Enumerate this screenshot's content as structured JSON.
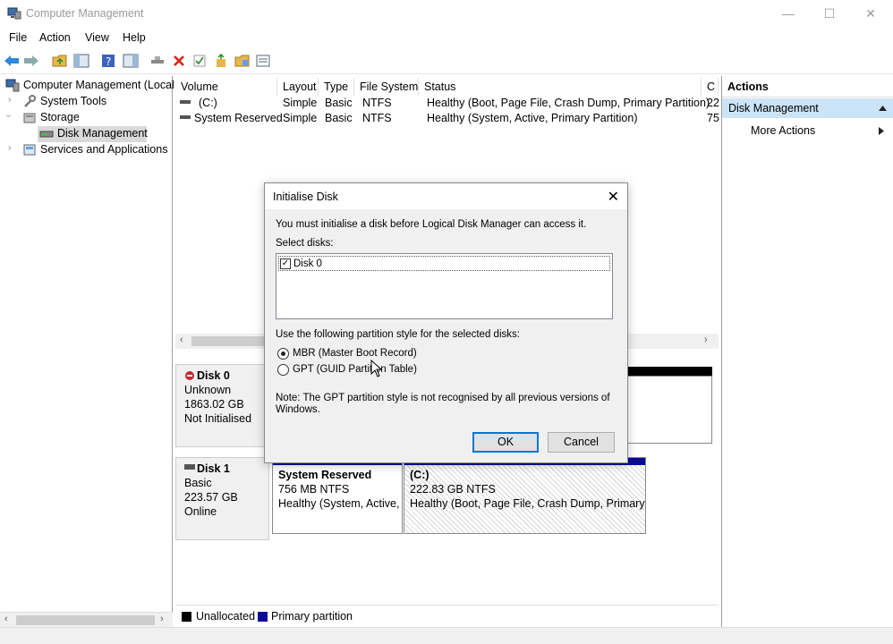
{
  "window": {
    "title": "Computer Management",
    "minimize": "—",
    "maximize": "☐",
    "close": "✕"
  },
  "menu": [
    "File",
    "Action",
    "View",
    "Help"
  ],
  "tree": {
    "root": "Computer Management (Local",
    "system_tools": "System Tools",
    "storage": "Storage",
    "disk_management": "Disk Management",
    "services": "Services and Applications"
  },
  "columns": [
    "Volume",
    "Layout",
    "Type",
    "File System",
    "Status",
    "C"
  ],
  "volumes": [
    {
      "volume": "(C:)",
      "layout": "Simple",
      "type": "Basic",
      "fs": "NTFS",
      "status": "Healthy (Boot, Page File, Crash Dump, Primary Partition)",
      "cap": "22"
    },
    {
      "volume": "System Reserved",
      "layout": "Simple",
      "type": "Basic",
      "fs": "NTFS",
      "status": "Healthy (System, Active, Primary Partition)",
      "cap": "75"
    }
  ],
  "disks": [
    {
      "name": "Disk 0",
      "type": "Unknown",
      "size": "1863.02 GB",
      "state": "Not Initialised"
    },
    {
      "name": "Disk 1",
      "type": "Basic",
      "size": "223.57 GB",
      "state": "Online"
    }
  ],
  "partitions": [
    {
      "name": "System Reserved",
      "size": "756 MB NTFS",
      "status": "Healthy (System, Active,"
    },
    {
      "name": "(C:)",
      "size": "222.83 GB NTFS",
      "status": "Healthy (Boot, Page File, Crash Dump, Primary P"
    }
  ],
  "legend": {
    "unallocated": "Unallocated",
    "primary": "Primary partition",
    "unallocated_color": "#000000",
    "primary_color": "#0a0a9a"
  },
  "actions": {
    "header": "Actions",
    "selected": "Disk Management",
    "more": "More Actions"
  },
  "dialog": {
    "title": "Initialise Disk",
    "intro": "You must initialise a disk before Logical Disk Manager can access it.",
    "select_label": "Select disks:",
    "disk_item": "Disk 0",
    "style_label": "Use the following partition style for the selected disks:",
    "mbr": "MBR (Master Boot Record)",
    "gpt": "GPT (GUID Partition Table)",
    "note_line1": "Note: The GPT partition style is not recognised by all previous versions of",
    "note_line2": "Windows.",
    "ok": "OK",
    "cancel": "Cancel"
  }
}
